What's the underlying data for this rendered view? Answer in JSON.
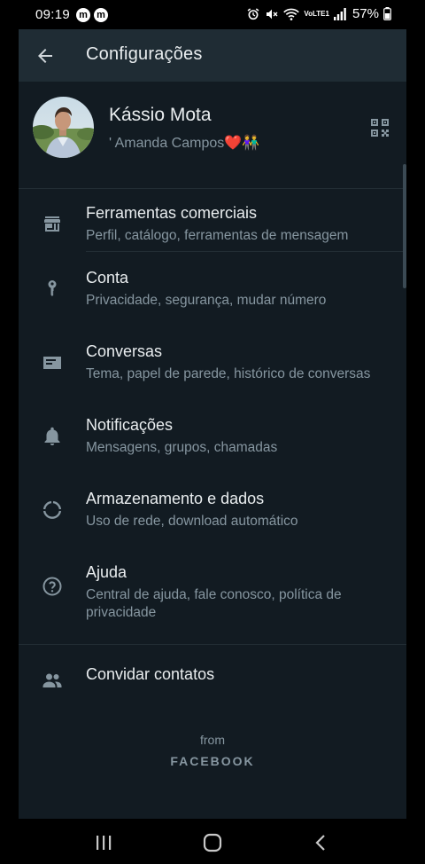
{
  "status_bar": {
    "time": "09:19",
    "app_icons": [
      "m",
      "m"
    ],
    "icons": [
      "alarm-icon",
      "mute-icon",
      "wifi-icon",
      "volte-icon",
      "signal-icon"
    ],
    "volte_label": "VoLTE1",
    "battery": "57%"
  },
  "appbar": {
    "title": "Configurações"
  },
  "profile": {
    "name": "Kássio Mota",
    "about": "' Amanda Campos❤️👫"
  },
  "menu": [
    {
      "id": "business",
      "label": "Ferramentas comerciais",
      "sub": "Perfil, catálogo, ferramentas de mensagem",
      "icon": "store-icon"
    },
    {
      "id": "account",
      "label": "Conta",
      "sub": "Privacidade, segurança, mudar número",
      "icon": "key-icon"
    },
    {
      "id": "chats",
      "label": "Conversas",
      "sub": "Tema, papel de parede, histórico de conversas",
      "icon": "chat-icon"
    },
    {
      "id": "notifications",
      "label": "Notificações",
      "sub": "Mensagens, grupos, chamadas",
      "icon": "bell-icon"
    },
    {
      "id": "storage",
      "label": "Armazenamento e dados",
      "sub": "Uso de rede, download automático",
      "icon": "data-usage-icon"
    },
    {
      "id": "help",
      "label": "Ajuda",
      "sub": "Central de ajuda, fale conosco, política de privacidade",
      "icon": "help-icon"
    }
  ],
  "invite": {
    "label": "Convidar contatos",
    "icon": "people-icon"
  },
  "footer": {
    "from": "from",
    "brand": "FACEBOOK"
  },
  "navbar": {
    "buttons": [
      "recents-icon",
      "home-icon",
      "back-icon"
    ]
  },
  "colors": {
    "background": "#121b22",
    "appbar": "#1f2c34",
    "text_primary": "#e9edef",
    "text_secondary": "#8696a0",
    "icon": "#8696a0"
  }
}
